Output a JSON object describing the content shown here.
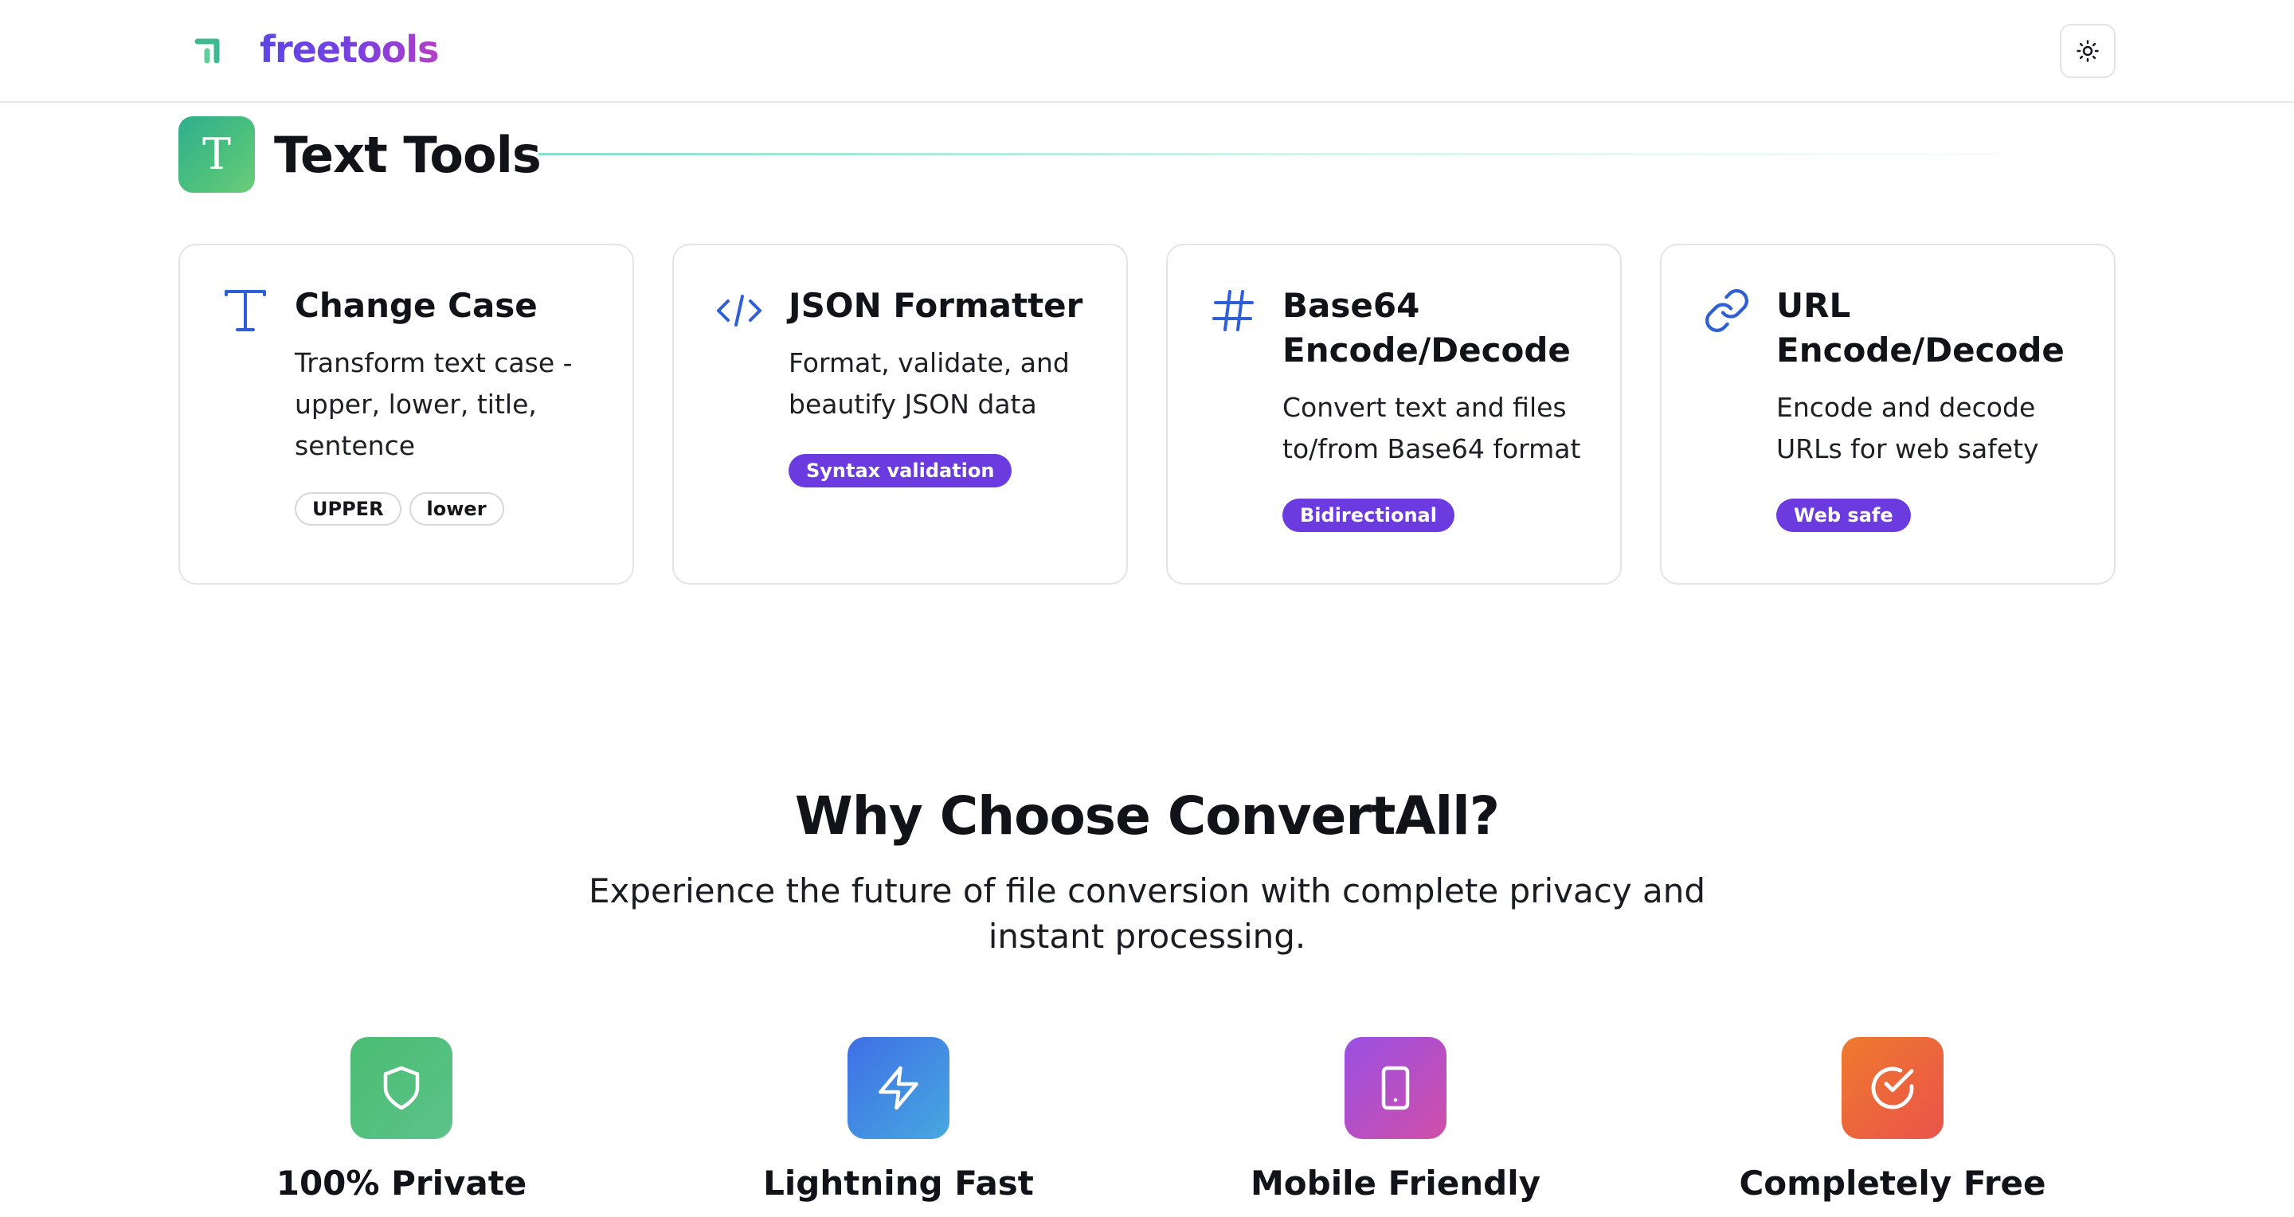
{
  "header": {
    "logo_text": "freetools",
    "theme_toggle_icon": "sun-icon"
  },
  "section": {
    "title": "Text Tools",
    "icon_letter": "T"
  },
  "cards": [
    {
      "title": "Change Case",
      "icon": "text-case-icon",
      "description": "Transform text case - upper, lower, title, sentence",
      "tags": [
        "UPPER",
        "lower"
      ]
    },
    {
      "title": "JSON Formatter",
      "icon": "code-icon",
      "description": "Format, validate, and beautify JSON data",
      "badge": "Syntax validation"
    },
    {
      "title": "Base64 Encode/Decode",
      "icon": "hash-icon",
      "description": "Convert text and files to/from Base64 format",
      "badge": "Bidirectional"
    },
    {
      "title": "URL Encode/Decode",
      "icon": "link-icon",
      "description": "Encode and decode URLs for web safety",
      "badge": "Web safe"
    }
  ],
  "why": {
    "title": "Why Choose ConvertAll?",
    "subtitle": "Experience the future of file conversion with complete privacy and instant processing."
  },
  "features": [
    {
      "label": "100% Private",
      "icon": "shield-icon"
    },
    {
      "label": "Lightning Fast",
      "icon": "lightning-icon"
    },
    {
      "label": "Mobile Friendly",
      "icon": "smartphone-icon"
    },
    {
      "label": "Completely Free",
      "icon": "check-circle-icon"
    }
  ],
  "colors": {
    "brand_purple": "#6b3be0",
    "accent_blue": "#2f5fd6",
    "green": "#4bc07d"
  }
}
